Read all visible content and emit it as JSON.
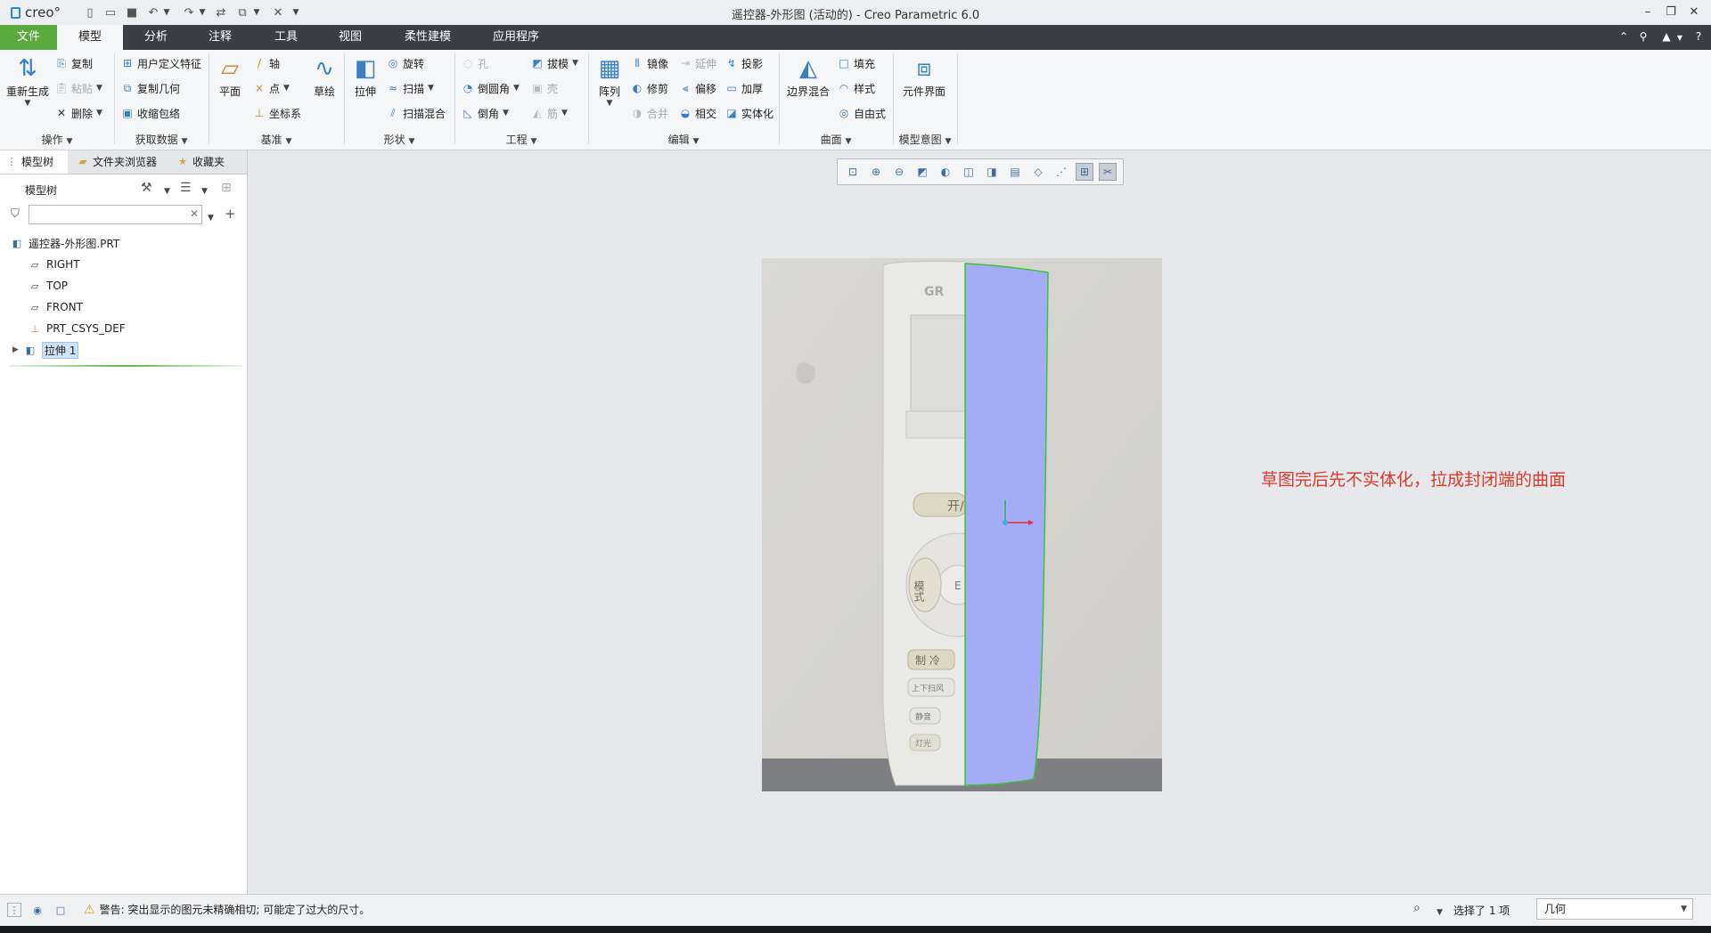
{
  "app": {
    "logo_text": "creo°",
    "title": "遥控器-外形图 (活动的) - Creo Parametric 6.0"
  },
  "menu_tabs": [
    "文件",
    "模型",
    "分析",
    "注释",
    "工具",
    "视图",
    "柔性建模",
    "应用程序"
  ],
  "ribbon": {
    "operations": {
      "label": "操作",
      "regenerate": "重新生成",
      "copy": "复制",
      "paste": "粘贴",
      "delete": "删除"
    },
    "get_data": {
      "label": "获取数据",
      "udf": "用户定义特征",
      "copy_geom": "复制几何",
      "shrinkwrap": "收缩包络"
    },
    "datum": {
      "label": "基准",
      "plane": "平面",
      "axis": "轴",
      "point": "点",
      "csys": "坐标系",
      "sketch": "草绘"
    },
    "shapes": {
      "label": "形状",
      "extrude": "拉伸",
      "revolve": "旋转",
      "sweep": "扫描",
      "swept_blend": "扫描混合"
    },
    "engineering": {
      "label": "工程",
      "hole": "孔",
      "round": "倒圆角",
      "chamfer": "倒角",
      "draft": "拔模",
      "shell": "壳",
      "rib": "筋"
    },
    "editing": {
      "label": "编辑",
      "pattern": "阵列",
      "mirror": "镜像",
      "extend": "延伸",
      "project": "投影",
      "trim": "修剪",
      "offset": "偏移",
      "thicken": "加厚",
      "merge": "合并",
      "intersect": "相交",
      "solidify": "实体化"
    },
    "surfaces": {
      "label": "曲面",
      "boundary_blend": "边界混合",
      "fill": "填充",
      "style": "样式",
      "freestyle": "自由式"
    },
    "model_intent": {
      "label": "模型意图",
      "component_interface": "元件界面"
    }
  },
  "left_panel": {
    "tabs": [
      "模型树",
      "文件夹浏览器",
      "收藏夹"
    ],
    "header": "模型树",
    "filter_placeholder": "",
    "tree": [
      {
        "label": "遥控器-外形图.PRT",
        "icon": "part-icon"
      },
      {
        "label": "RIGHT",
        "icon": "datum-plane-icon"
      },
      {
        "label": "TOP",
        "icon": "datum-plane-icon"
      },
      {
        "label": "FRONT",
        "icon": "datum-plane-icon"
      },
      {
        "label": "PRT_CSYS_DEF",
        "icon": "csys-icon"
      },
      {
        "label": "拉伸 1",
        "icon": "extrude-icon",
        "selected": true
      }
    ]
  },
  "graphics": {
    "photo_texts": {
      "brand": "GR",
      "on": "开/",
      "mode": "模式",
      "cool": "制 冷",
      "swing": "上下扫风",
      "quiet": "静音",
      "light": "灯光",
      "center": "E"
    },
    "annotation": "草图完后先不实体化，拉成封闭端的曲面",
    "surface_color": "#a4acf8",
    "edge_color": "#3cc23c"
  },
  "status": {
    "message": "警告: 突出显示的图元未精确相切; 可能定了过大的尺寸。",
    "selection": "选择了 1 项",
    "filter_value": "几何"
  },
  "colors": {
    "file_tab": "#5aa93c",
    "tabbar": "#3a3e45",
    "annotation": "#d93a2b"
  }
}
